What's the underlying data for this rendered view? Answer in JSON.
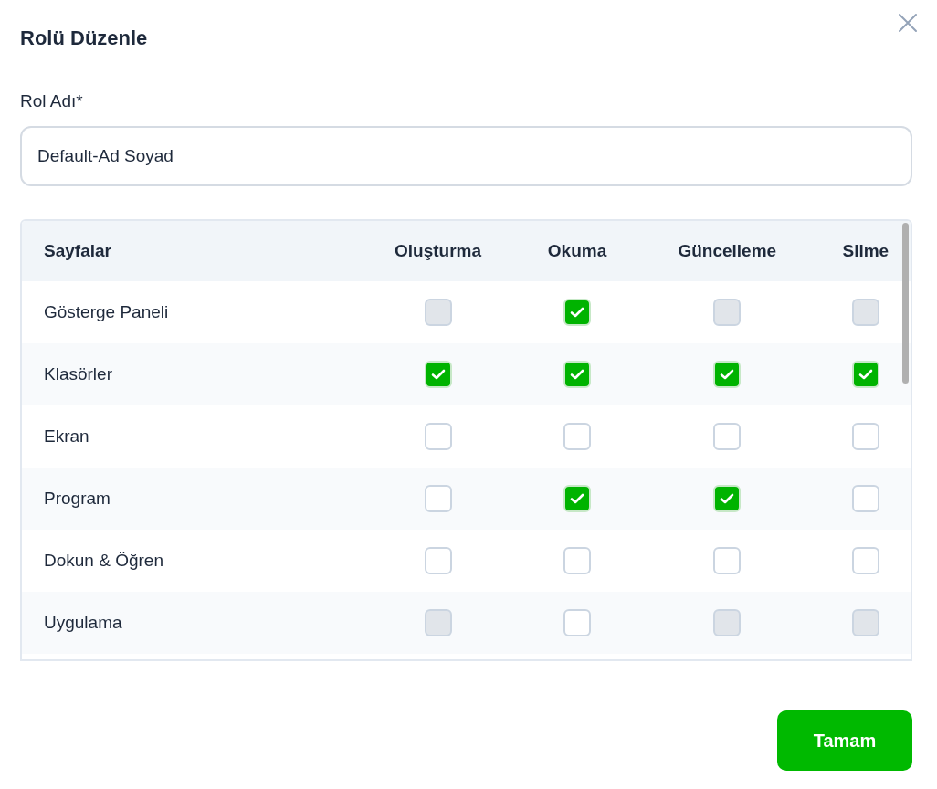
{
  "dialog": {
    "title": "Rolü Düzenle"
  },
  "role_name": {
    "label": "Rol Adı*",
    "value": "Default-Ad Soyad"
  },
  "table": {
    "columns": [
      "Sayfalar",
      "Oluşturma",
      "Okuma",
      "Güncelleme",
      "Silme"
    ],
    "rows": [
      {
        "page": "Gösterge Paneli",
        "permissions": [
          {
            "checked": false,
            "disabled": true
          },
          {
            "checked": true,
            "disabled": false
          },
          {
            "checked": false,
            "disabled": true
          },
          {
            "checked": false,
            "disabled": true
          }
        ]
      },
      {
        "page": "Klasörler",
        "permissions": [
          {
            "checked": true,
            "disabled": false
          },
          {
            "checked": true,
            "disabled": false
          },
          {
            "checked": true,
            "disabled": false
          },
          {
            "checked": true,
            "disabled": false
          }
        ]
      },
      {
        "page": "Ekran",
        "permissions": [
          {
            "checked": false,
            "disabled": false
          },
          {
            "checked": false,
            "disabled": false
          },
          {
            "checked": false,
            "disabled": false
          },
          {
            "checked": false,
            "disabled": false
          }
        ]
      },
      {
        "page": "Program",
        "permissions": [
          {
            "checked": false,
            "disabled": false
          },
          {
            "checked": true,
            "disabled": false
          },
          {
            "checked": true,
            "disabled": false
          },
          {
            "checked": false,
            "disabled": false
          }
        ]
      },
      {
        "page": "Dokun & Öğren",
        "permissions": [
          {
            "checked": false,
            "disabled": false
          },
          {
            "checked": false,
            "disabled": false
          },
          {
            "checked": false,
            "disabled": false
          },
          {
            "checked": false,
            "disabled": false
          }
        ]
      },
      {
        "page": "Uygulama",
        "permissions": [
          {
            "checked": false,
            "disabled": true
          },
          {
            "checked": false,
            "disabled": false
          },
          {
            "checked": false,
            "disabled": true
          },
          {
            "checked": false,
            "disabled": true
          }
        ]
      }
    ]
  },
  "buttons": [
    "Tamam"
  ]
}
